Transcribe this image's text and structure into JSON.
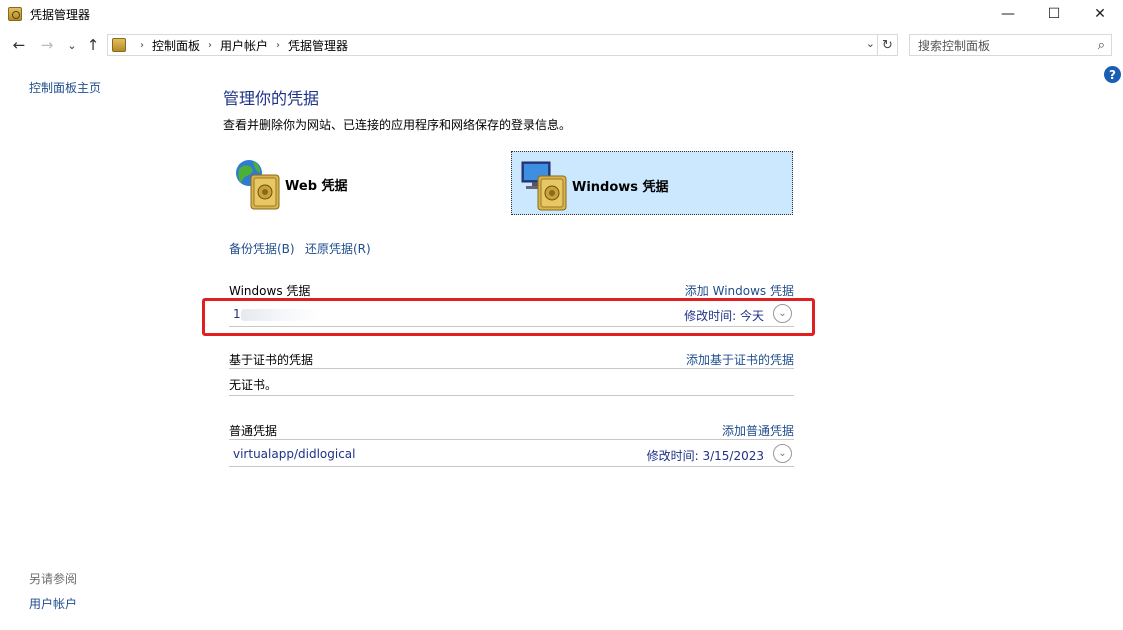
{
  "window": {
    "title": "凭据管理器",
    "minimize": "—",
    "maximize": "☐",
    "close": "✕"
  },
  "nav": {
    "back": "←",
    "forward": "→",
    "recent": "⌄",
    "up": "↑",
    "breadcrumb": [
      "控制面板",
      "用户帐户",
      "凭据管理器"
    ],
    "crumb_sep": "›",
    "dropdown": "⌄",
    "refresh": "↻",
    "search_placeholder": "搜索控制面板",
    "search_glyph": "⌕"
  },
  "help": "?",
  "left_pane": {
    "home_link": "控制面板主页",
    "see_also_title": "另请参阅",
    "see_also_link": "用户帐户"
  },
  "main": {
    "title": "管理你的凭据",
    "description": "查看并删除你为网站、已连接的应用程序和网络保存的登录信息。",
    "tiles": {
      "web": "Web 凭据",
      "windows": "Windows 凭据"
    },
    "backup_link": "备份凭据(B)",
    "restore_link": "还原凭据(R)",
    "sections": {
      "windows": {
        "title": "Windows 凭据",
        "add": "添加 Windows 凭据",
        "item_name": "1",
        "item_modified": "修改时间:  今天"
      },
      "cert": {
        "title": "基于证书的凭据",
        "add": "添加基于证书的凭据",
        "empty": "无证书。"
      },
      "generic": {
        "title": "普通凭据",
        "add": "添加普通凭据",
        "item_name": "virtualapp/didlogical",
        "item_modified": "修改时间:  3/15/2023"
      }
    },
    "expand_glyph": "⌄"
  },
  "colors": {
    "link": "#1f4e8c",
    "title": "#1e3287",
    "selected_tile": "#cce8ff",
    "highlight": "#e02020"
  }
}
